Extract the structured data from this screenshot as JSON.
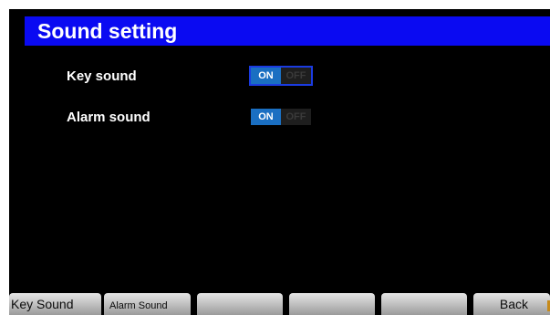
{
  "title": "Sound setting",
  "settings": [
    {
      "label": "Key sound",
      "on_label": "ON",
      "off_label": "OFF",
      "value": "ON",
      "focused": true
    },
    {
      "label": "Alarm sound",
      "on_label": "ON",
      "off_label": "OFF",
      "value": "ON",
      "focused": false
    }
  ],
  "softkeys": [
    "Key Sound",
    "Alarm Sound",
    "",
    "",
    "",
    "Back"
  ],
  "colors": {
    "title_bar": "#0a0af2",
    "toggle_on": "#1a6fc2",
    "focus_border": "#1b3be0",
    "background": "#000000"
  }
}
